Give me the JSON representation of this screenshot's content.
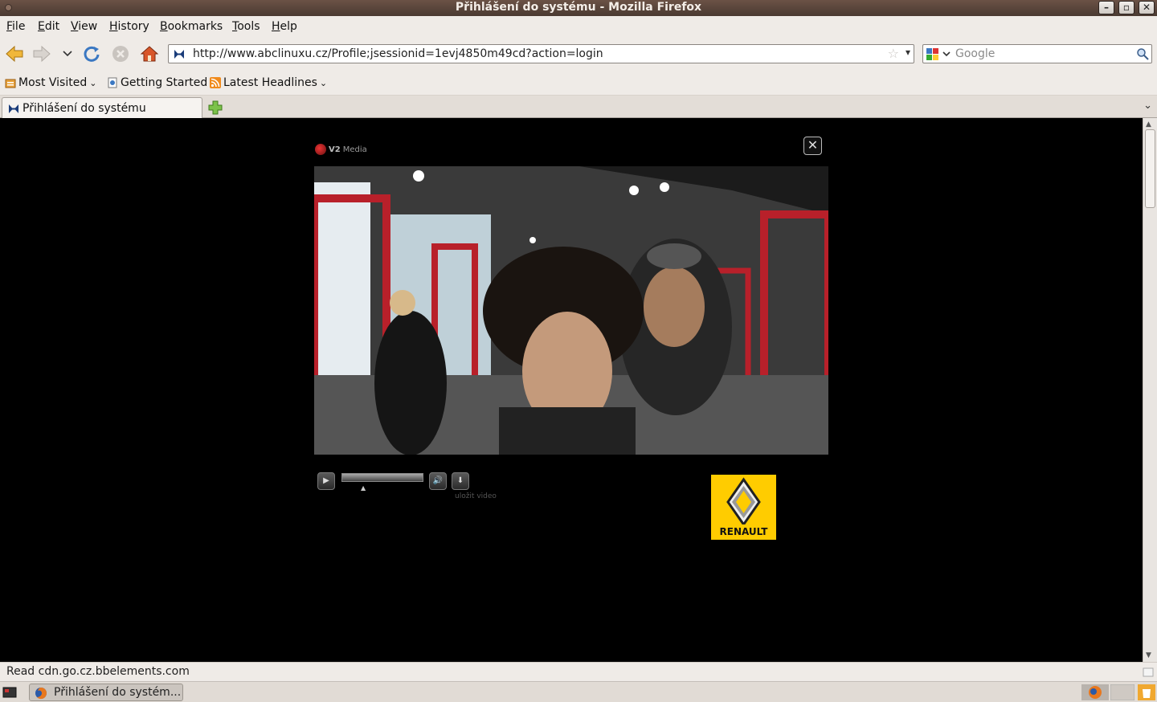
{
  "window": {
    "title": "Přihlášení do systému - Mozilla Firefox"
  },
  "menu": [
    "File",
    "Edit",
    "View",
    "History",
    "Bookmarks",
    "Tools",
    "Help"
  ],
  "nav": {
    "url": "http://www.abclinuxu.cz/Profile;jsessionid=1evj4850m49cd?action=login",
    "search_placeholder": "Google"
  },
  "bookmarks": {
    "most_visited": "Most Visited",
    "getting_started": "Getting Started",
    "latest_headlines": "Latest Headlines"
  },
  "tab": {
    "label": "Přihlášení do systému"
  },
  "player": {
    "brand_prefix": "V2",
    "brand_suffix": "Media",
    "save_video_label": "uložit video",
    "progress_fraction": 0.0,
    "ad_brand": "RENAULT"
  },
  "status": {
    "text": "Read cdn.go.cz.bbelements.com"
  },
  "taskbar": {
    "window_label": "Přihlášení do systém..."
  },
  "colors": {
    "accent": "#ffcc00",
    "titlebar": "#5a463c",
    "chrome": "#efebe7"
  }
}
